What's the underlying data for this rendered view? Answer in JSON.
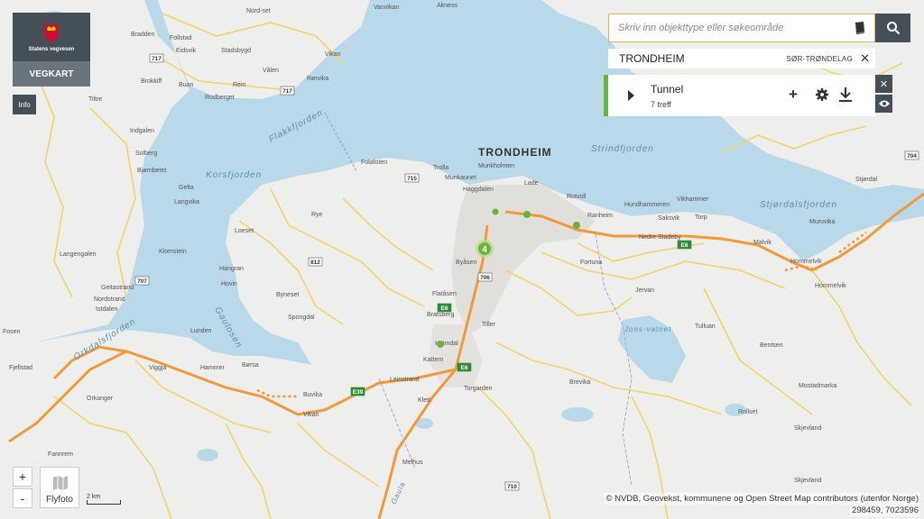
{
  "header": {
    "agency_name": "Statens vegvesen",
    "app_button": "VEGKART",
    "info_button": "Info"
  },
  "search": {
    "placeholder": "Skriv inn objekttype eller søkeområde",
    "value": ""
  },
  "area": {
    "name": "TRONDHEIM",
    "county": "SØR-TRØNDELAG"
  },
  "result": {
    "title": "Tunnel",
    "count": "7 treff",
    "marker_count": "4"
  },
  "controls": {
    "zoom_in": "+",
    "zoom_out": "-",
    "flyfoto": "Flyfoto",
    "scale": "2 km"
  },
  "footer": {
    "attribution": "© NVDB, Geovekst, kommunene og Open Street Map contributors (utenfor Norge)",
    "coordinates": "298459, 7023596"
  },
  "map": {
    "city": "TRONDHEIM",
    "water_labels": [
      "Korsfjorden",
      "Flakkfjorden",
      "Strindfjorden",
      "Stjørdalsfjorden",
      "Orkdalsfjorden",
      "Gaulosen",
      "Jons-vatnet",
      "Gaula"
    ],
    "place_labels": [
      "Nord-set",
      "Vanvikan",
      "Akness",
      "Bradden",
      "Follstad",
      "Eidsvik",
      "Stadsbygd",
      "Vikan",
      "Rørvika",
      "Brokkiff",
      "Buan",
      "Rein",
      "Rodberget",
      "Vålen",
      "Tiltre",
      "Indgalen",
      "Solberg",
      "Bjørnbetet",
      "Gelta",
      "Langvika",
      "Langengalen",
      "Klomstein",
      "Geitastrand",
      "Nordstrand",
      "Istdalen",
      "Fosen",
      "Folafoten",
      "Trolla",
      "Munkholmen",
      "Munkaunet",
      "Haggdalen",
      "Lade",
      "Rotvoll",
      "Vikhammer",
      "Ranheim",
      "Hommelvik",
      "Stjørdal",
      "Muruvika",
      "Hundhammeren",
      "Malvik",
      "Torp",
      "Hommelvik",
      "Saksvik",
      "Nedre Stadeby",
      "Heimdal",
      "Melhus",
      "Kattem",
      "Tiller",
      "Bratsberg",
      "Flatåsen",
      "Byåsen",
      "Børsa",
      "Buvika",
      "Orkanger",
      "Fannrem",
      "Hammer",
      "Viggja",
      "Lunden",
      "Vikan",
      "Klett",
      "Torgarden",
      "Leinstrand",
      "Byneset",
      "Spongdal",
      "Hangran",
      "Rye",
      "Loeset",
      "Hovin",
      "Jervan",
      "Fortuna",
      "Fjellstad",
      "Brevika",
      "Tulluan",
      "Rollset",
      "Mostadmarka",
      "Skjevland",
      "Bentsen",
      "Skjevland"
    ],
    "road_shields": [
      "717",
      "717",
      "715",
      "706",
      "E6",
      "E6",
      "E39",
      "E6",
      "812",
      "707",
      "710",
      "704"
    ]
  }
}
